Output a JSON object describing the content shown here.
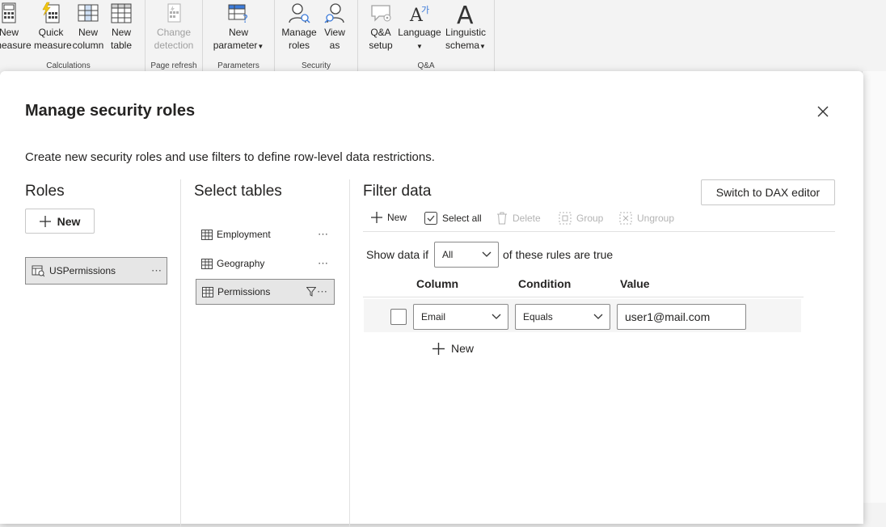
{
  "ribbon": {
    "calculations": {
      "label": "Calculations",
      "buttons": [
        {
          "line1": "New",
          "line2": "measure"
        },
        {
          "line1": "Quick",
          "line2": "measure"
        },
        {
          "line1": "New",
          "line2": "column"
        },
        {
          "line1": "New",
          "line2": "table"
        }
      ]
    },
    "page_refresh": {
      "label": "Page refresh",
      "buttons": [
        {
          "line1": "Change",
          "line2": "detection"
        }
      ]
    },
    "parameters": {
      "label": "Parameters",
      "buttons": [
        {
          "line1": "New",
          "line2": "parameter"
        }
      ]
    },
    "security": {
      "label": "Security",
      "buttons": [
        {
          "line1": "Manage",
          "line2": "roles"
        },
        {
          "line1": "View",
          "line2": "as"
        }
      ]
    },
    "qa": {
      "label": "Q&A",
      "buttons": [
        {
          "line1": "Q&A",
          "line2": "setup"
        },
        {
          "line1": "Language",
          "line2": ""
        },
        {
          "line1": "Linguistic",
          "line2": "schema"
        }
      ]
    }
  },
  "dialog": {
    "title": "Manage security roles",
    "description": "Create new security roles and use filters to define row-level data restrictions.",
    "roles": {
      "heading": "Roles",
      "new_label": "New",
      "items": [
        {
          "name": "USPermissions"
        }
      ]
    },
    "tables": {
      "heading": "Select tables",
      "items": [
        {
          "name": "Employment"
        },
        {
          "name": "Geography"
        },
        {
          "name": "Permissions"
        }
      ]
    },
    "filter": {
      "heading": "Filter data",
      "switch_label": "Switch to DAX editor",
      "toolbar": {
        "new": "New",
        "select_all": "Select all",
        "delete": "Delete",
        "group": "Group",
        "ungroup": "Ungroup"
      },
      "show_data_if": "Show data if",
      "mode": "All",
      "suffix": "of these rules are true",
      "columns": {
        "column": "Column",
        "condition": "Condition",
        "value": "Value"
      },
      "rules": [
        {
          "column": "Email",
          "condition": "Equals",
          "value": "user1@mail.com"
        }
      ],
      "add_rule_label": "New"
    }
  },
  "colors": {
    "accent": "#f2c811",
    "border": "#8a8a8a",
    "selected_bg": "#e6e6e6"
  }
}
